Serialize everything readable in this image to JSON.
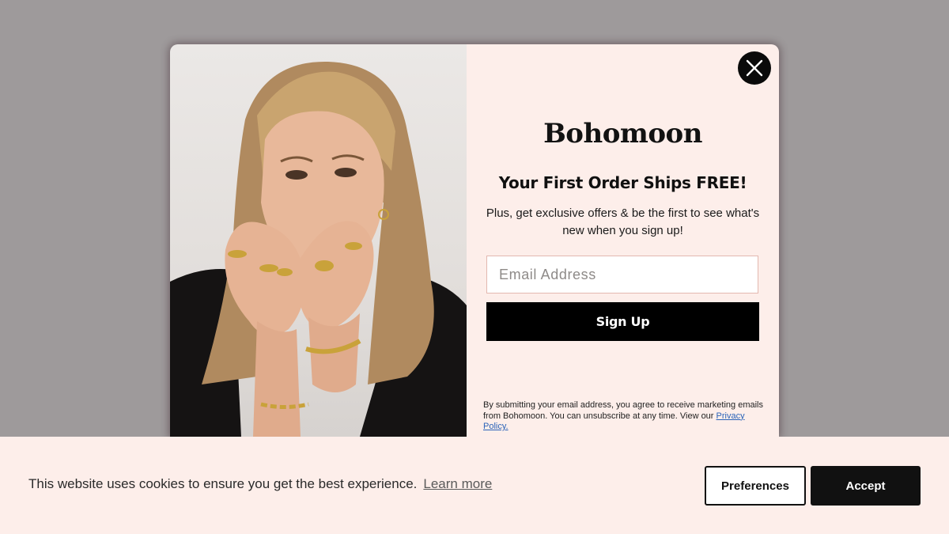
{
  "popup": {
    "brand": "Bohomoon",
    "headline": "Your First Order Ships FREE!",
    "subtext": "Plus, get exclusive offers & be the first to see what's new when you sign up!",
    "email_placeholder": "Email Address",
    "signup_label": "Sign Up",
    "legal_text": "By submitting your email address, you agree to receive marketing emails from Bohomoon. You can unsubscribe at any time. View our ",
    "privacy_link": "Privacy Policy.",
    "close_icon": "close-icon",
    "colors": {
      "panel_bg": "#fdeeea",
      "button_bg": "#000000",
      "input_border": "#e3b8b0",
      "link": "#2a62b8"
    }
  },
  "cookie_banner": {
    "message": "This website uses cookies to ensure you get the best experience.",
    "learn_more": "Learn more",
    "preferences_label": "Preferences",
    "accept_label": "Accept"
  },
  "overlay_color": "#9e9a9b"
}
